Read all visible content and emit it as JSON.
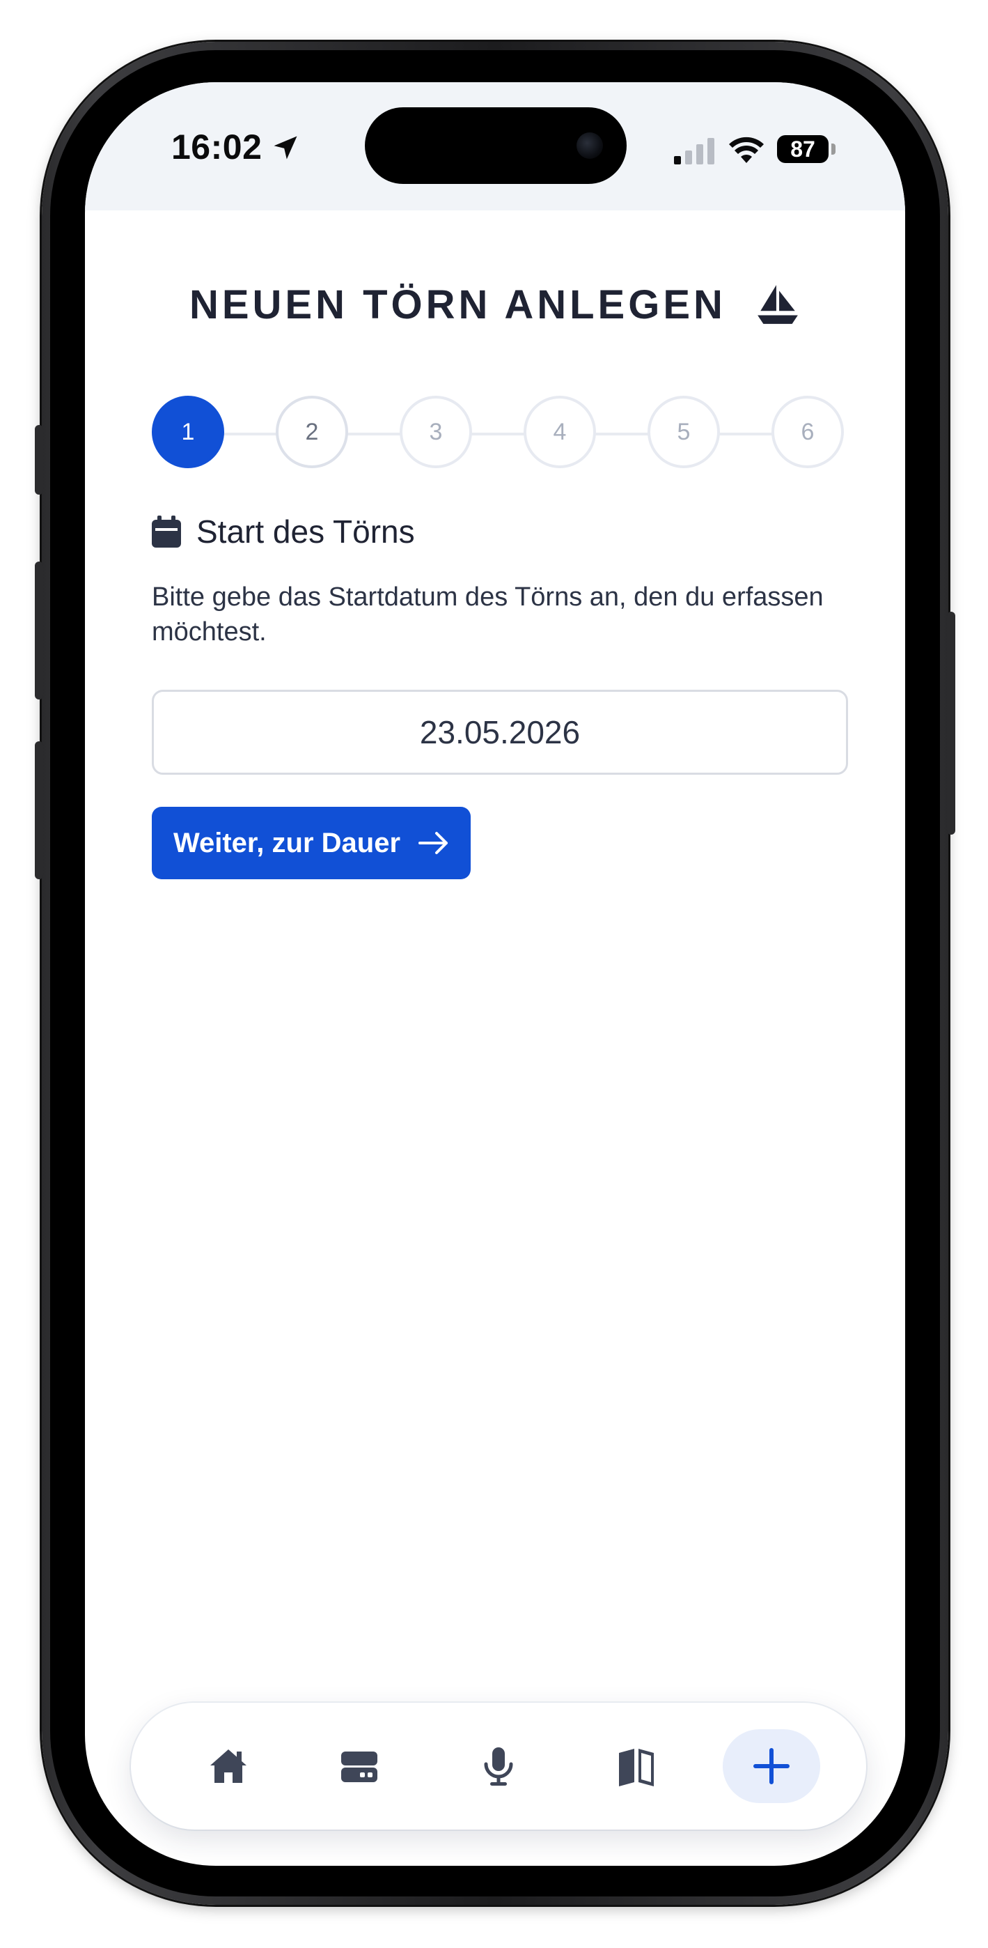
{
  "status_bar": {
    "time": "16:02",
    "battery": "87"
  },
  "page": {
    "title": "NEUEN TÖRN ANLEGEN"
  },
  "stepper": {
    "steps": [
      "1",
      "2",
      "3",
      "4",
      "5",
      "6"
    ],
    "active": 1
  },
  "section": {
    "title": "Start des Törns",
    "instruction": "Bitte gebe das Startdatum des Törns an, den du erfassen möchtest."
  },
  "date_input": {
    "value": "23.05.2026"
  },
  "next_button": {
    "label": "Weiter, zur Dauer"
  },
  "tabbar": {
    "items": [
      {
        "icon": "home-icon"
      },
      {
        "icon": "wallet-icon"
      },
      {
        "icon": "microphone-icon"
      },
      {
        "icon": "book-icon"
      },
      {
        "icon": "plus-icon",
        "active": true
      }
    ]
  },
  "colors": {
    "accent": "#1150d6",
    "text_dark": "#1f2333",
    "text_body": "#2c3345",
    "tab_icon": "#3f4658",
    "status_bg": "#f1f4f8"
  }
}
